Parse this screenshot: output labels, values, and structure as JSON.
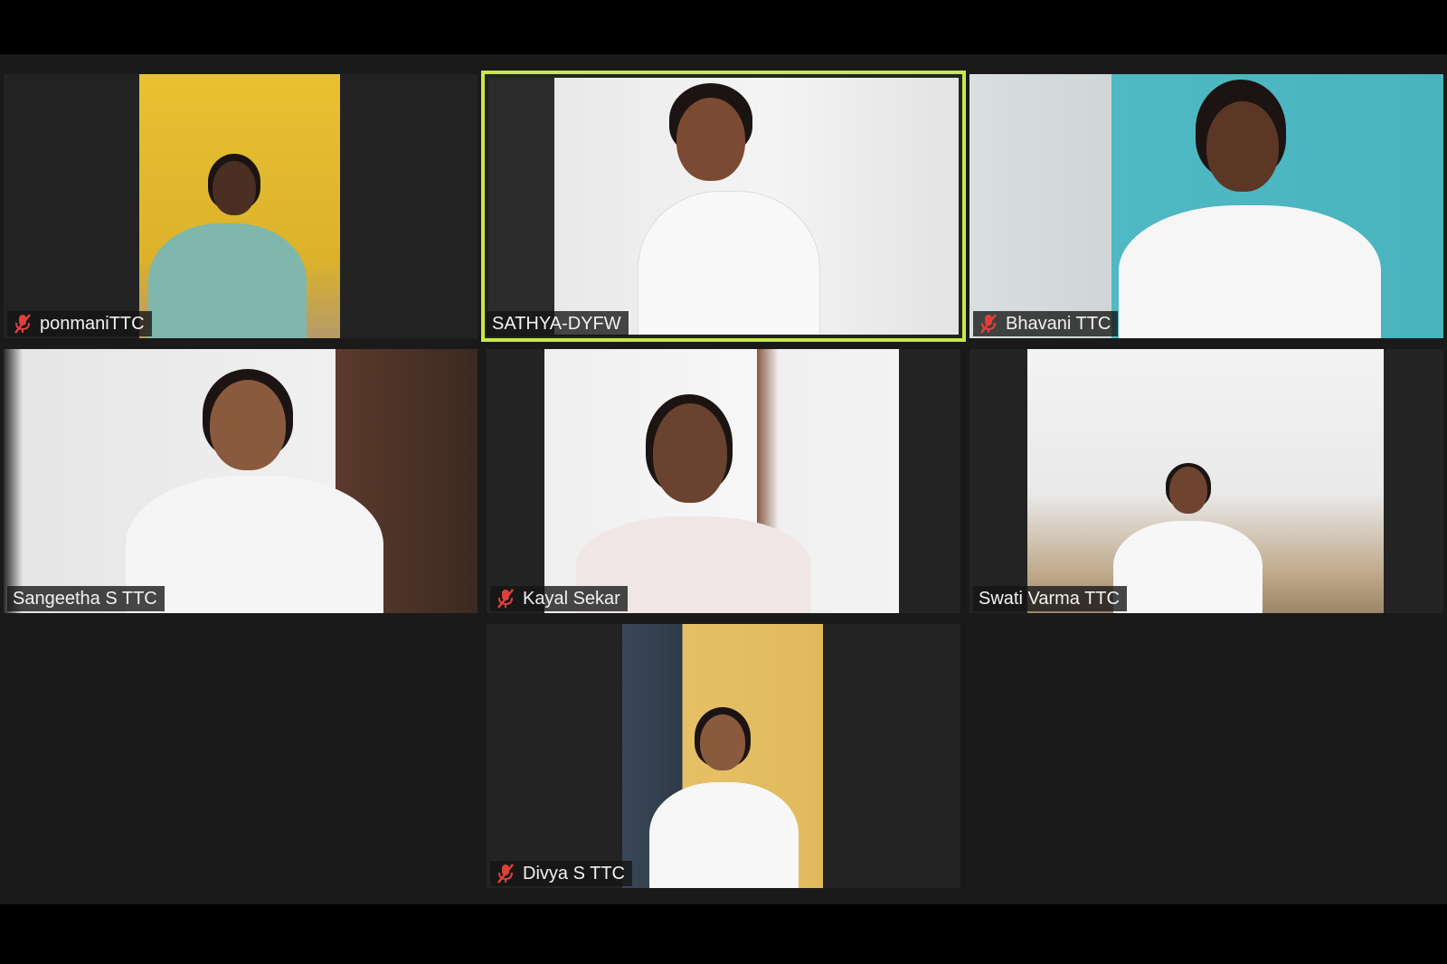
{
  "participants": [
    {
      "name": "ponmaniTTC",
      "muted": true,
      "active": false
    },
    {
      "name": "SATHYA-DYFW",
      "muted": false,
      "active": true
    },
    {
      "name": "Bhavani TTC",
      "muted": true,
      "active": false
    },
    {
      "name": "Sangeetha S TTC",
      "muted": false,
      "active": false
    },
    {
      "name": "Kayal Sekar",
      "muted": true,
      "active": false
    },
    {
      "name": "Swati Varma TTC",
      "muted": false,
      "active": false
    },
    {
      "name": "Divya S TTC",
      "muted": true,
      "active": false
    }
  ],
  "colors": {
    "active_speaker_border": "#c8e84a",
    "mute_icon": "#e0403a",
    "tile_background": "#232323"
  }
}
